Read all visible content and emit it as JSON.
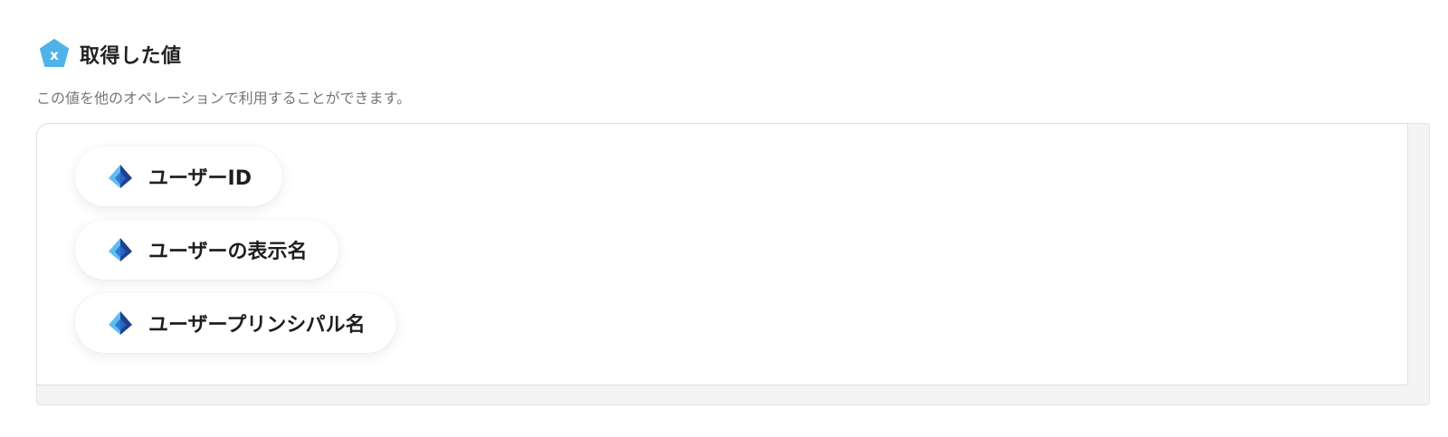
{
  "section": {
    "title": "取得した値",
    "description": "この値を他のオペレーションで利用することができます。",
    "icon": "variable-pentagon-icon",
    "accent_color": "#4fb3e8"
  },
  "values": [
    {
      "label": "ユーザーID",
      "icon": "azure-ad-icon"
    },
    {
      "label": "ユーザーの表示名",
      "icon": "azure-ad-icon"
    },
    {
      "label": "ユーザープリンシパル名",
      "icon": "azure-ad-icon"
    }
  ]
}
